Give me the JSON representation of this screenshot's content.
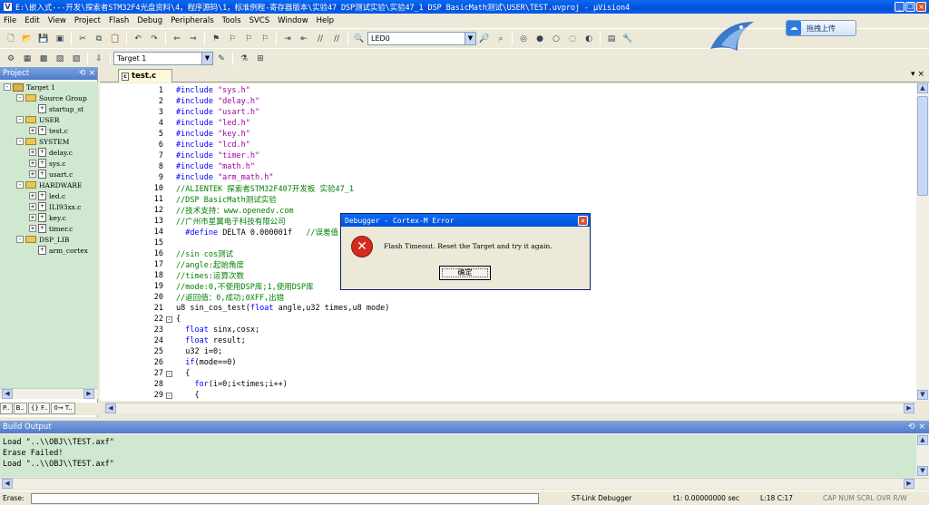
{
  "window": {
    "title": "E:\\嵌入式---开发\\探索者STM32F4光盘资料\\4，程序源码\\1，标准例程-寄存器版本\\实验47 DSP测试实验\\实验47_1 DSP BasicMath测试\\USER\\TEST.uvproj - µVision4"
  },
  "menu": [
    "File",
    "Edit",
    "View",
    "Project",
    "Flash",
    "Debug",
    "Peripherals",
    "Tools",
    "SVCS",
    "Window",
    "Help"
  ],
  "toolbar": {
    "find_combo": "LED0",
    "target_combo": "Target 1",
    "upload_label": "拖拽上传"
  },
  "project": {
    "title": "Project",
    "tree": [
      {
        "label": "Target 1",
        "level": 0,
        "kind": "target",
        "expand": "-"
      },
      {
        "label": "Source Group",
        "level": 1,
        "kind": "folder",
        "expand": "-"
      },
      {
        "label": "startup_st",
        "level": 2,
        "kind": "file",
        "expand": ""
      },
      {
        "label": "USER",
        "level": 1,
        "kind": "folder",
        "expand": "-"
      },
      {
        "label": "test.c",
        "level": 2,
        "kind": "file",
        "expand": "+"
      },
      {
        "label": "SYSTEM",
        "level": 1,
        "kind": "folder",
        "expand": "-"
      },
      {
        "label": "delay.c",
        "level": 2,
        "kind": "file",
        "expand": "+"
      },
      {
        "label": "sys.c",
        "level": 2,
        "kind": "file",
        "expand": "+"
      },
      {
        "label": "usart.c",
        "level": 2,
        "kind": "file",
        "expand": "+"
      },
      {
        "label": "HARDWARE",
        "level": 1,
        "kind": "folder",
        "expand": "-"
      },
      {
        "label": "led.c",
        "level": 2,
        "kind": "file",
        "expand": "+"
      },
      {
        "label": "ILI93xx.c",
        "level": 2,
        "kind": "file",
        "expand": "+"
      },
      {
        "label": "key.c",
        "level": 2,
        "kind": "file",
        "expand": "+"
      },
      {
        "label": "timer.c",
        "level": 2,
        "kind": "file",
        "expand": "+"
      },
      {
        "label": "DSP_LIB",
        "level": 1,
        "kind": "folder",
        "expand": "-"
      },
      {
        "label": "arm_cortex",
        "level": 2,
        "kind": "file",
        "expand": ""
      }
    ],
    "tabs": [
      "P..",
      "B..",
      "{} F..",
      "0→ T.."
    ]
  },
  "editor": {
    "tab": "test.c",
    "lines": [
      {
        "n": "1",
        "fold": "",
        "parts": [
          [
            "cp",
            "#include "
          ],
          [
            "cs",
            "\"sys.h\""
          ]
        ]
      },
      {
        "n": "2",
        "fold": "",
        "parts": [
          [
            "cp",
            "#include "
          ],
          [
            "cs",
            "\"delay.h\""
          ]
        ]
      },
      {
        "n": "3",
        "fold": "",
        "parts": [
          [
            "cp",
            "#include "
          ],
          [
            "cs",
            "\"usart.h\""
          ]
        ]
      },
      {
        "n": "4",
        "fold": "",
        "parts": [
          [
            "cp",
            "#include "
          ],
          [
            "cs",
            "\"led.h\""
          ]
        ]
      },
      {
        "n": "5",
        "fold": "",
        "parts": [
          [
            "cp",
            "#include "
          ],
          [
            "cs",
            "\"key.h\""
          ]
        ]
      },
      {
        "n": "6",
        "fold": "",
        "parts": [
          [
            "cp",
            "#include "
          ],
          [
            "cs",
            "\"lcd.h\""
          ]
        ]
      },
      {
        "n": "7",
        "fold": "",
        "parts": [
          [
            "cp",
            "#include "
          ],
          [
            "cs",
            "\"timer.h\""
          ]
        ]
      },
      {
        "n": "8",
        "fold": "",
        "parts": [
          [
            "cp",
            "#include "
          ],
          [
            "cs",
            "\"math.h\""
          ]
        ]
      },
      {
        "n": "9",
        "fold": "",
        "parts": [
          [
            "cp",
            "#include "
          ],
          [
            "cs",
            "\"arm_math.h\""
          ]
        ]
      },
      {
        "n": "10",
        "fold": "",
        "parts": [
          [
            "cc",
            "//ALIENTEK 探索者STM32F407开发板 实验47_1"
          ]
        ]
      },
      {
        "n": "11",
        "fold": "",
        "parts": [
          [
            "cc",
            "//DSP BasicMath测试实验"
          ]
        ]
      },
      {
        "n": "12",
        "fold": "",
        "parts": [
          [
            "cc",
            "//技术支持：www.openedv.com"
          ]
        ]
      },
      {
        "n": "13",
        "fold": "",
        "parts": [
          [
            "cc",
            "//广州市星翼电子科技有限公司"
          ]
        ]
      },
      {
        "n": "14",
        "fold": "",
        "parts": [
          [
            "cp",
            "  #define "
          ],
          [
            "",
            "DELTA 0.000001f   "
          ],
          [
            "cc",
            "//误差值"
          ]
        ]
      },
      {
        "n": "15",
        "fold": "",
        "parts": []
      },
      {
        "n": "16",
        "fold": "",
        "parts": [
          [
            "cc",
            "//sin cos测试"
          ]
        ]
      },
      {
        "n": "17",
        "fold": "",
        "parts": [
          [
            "cc",
            "//angle:起始角度"
          ]
        ]
      },
      {
        "n": "18",
        "fold": "",
        "parts": [
          [
            "cc",
            "//times:运算次数"
          ]
        ]
      },
      {
        "n": "19",
        "fold": "",
        "parts": [
          [
            "cc",
            "//mode:0,不使用DSP库;1,使用DSP库"
          ]
        ]
      },
      {
        "n": "20",
        "fold": "",
        "parts": [
          [
            "cc",
            "//返回值：0,成功;0XFF,出错"
          ]
        ]
      },
      {
        "n": "21",
        "fold": "",
        "parts": [
          [
            "",
            "u8 sin_cos_test("
          ],
          [
            "ck",
            "float"
          ],
          [
            "",
            " angle,u32 times,u8 mode)"
          ]
        ]
      },
      {
        "n": "22",
        "fold": "-",
        "parts": [
          [
            "",
            "{"
          ]
        ]
      },
      {
        "n": "23",
        "fold": "",
        "parts": [
          [
            "ck",
            "  float"
          ],
          [
            "",
            " sinx,cosx;"
          ]
        ]
      },
      {
        "n": "24",
        "fold": "",
        "parts": [
          [
            "ck",
            "  float"
          ],
          [
            "",
            " result;"
          ]
        ]
      },
      {
        "n": "25",
        "fold": "",
        "parts": [
          [
            "",
            "  u32 i=0;"
          ]
        ]
      },
      {
        "n": "26",
        "fold": "",
        "parts": [
          [
            "ck",
            "  if"
          ],
          [
            "",
            "(mode==0)"
          ]
        ]
      },
      {
        "n": "27",
        "fold": "-",
        "parts": [
          [
            "",
            "  {"
          ]
        ]
      },
      {
        "n": "28",
        "fold": "",
        "parts": [
          [
            "ck",
            "    for"
          ],
          [
            "",
            "(i=0;i<times;i++)"
          ]
        ]
      },
      {
        "n": "29",
        "fold": "-",
        "parts": [
          [
            "",
            "    {"
          ]
        ]
      }
    ]
  },
  "dialog": {
    "title": "Debugger - Cortex-M Error",
    "message": "Flash Timeout. Reset the Target and try it again.",
    "ok_label": "确定"
  },
  "build": {
    "title": "Build Output",
    "lines": [
      "Load \"..\\\\OBJ\\\\TEST.axf\"",
      "Erase Failed!",
      "Load \"..\\\\OBJ\\\\TEST.axf\""
    ]
  },
  "status": {
    "label": "Erase:",
    "debugger": "ST-Link Debugger",
    "time": "t1: 0.00000000 sec",
    "position": "L:18 C:17",
    "indicators": "CAP  NUM  SCRL  OVR  R/W"
  }
}
